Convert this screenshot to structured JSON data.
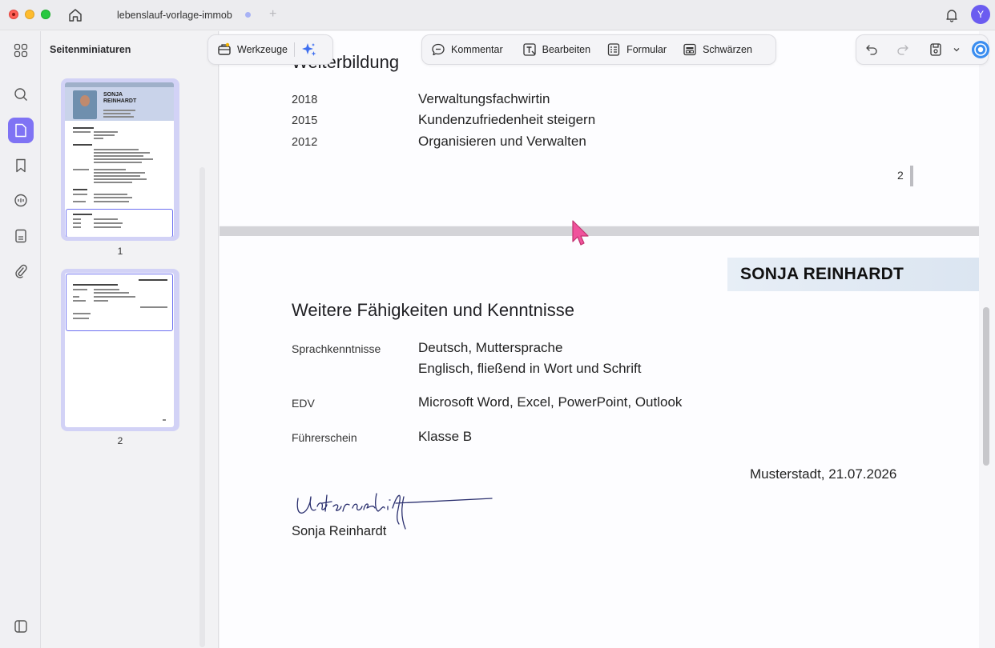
{
  "titlebar": {
    "tab_title": "lebenslauf-vorlage-immob",
    "new_tab": "+",
    "avatar_initial": "Y"
  },
  "thumbnails": {
    "title": "Seitenminiaturen",
    "pages": [
      {
        "number": "1",
        "name_line1": "SONJA",
        "name_line2": "REINHARDT"
      },
      {
        "number": "2"
      }
    ]
  },
  "toolbar": {
    "tools_label": "Werkzeuge",
    "comment_label": "Kommentar",
    "edit_label": "Bearbeiten",
    "form_label": "Formular",
    "redact_label": "Schwärzen"
  },
  "document": {
    "page1": {
      "section_title": "Weiterbildung",
      "rows": [
        {
          "year": "2018",
          "value": "Verwaltungsfachwirtin"
        },
        {
          "year": "2015",
          "value": "Kundenzufriedenheit steigern"
        },
        {
          "year": "2012",
          "value": "Organisieren und Verwalten"
        }
      ],
      "page_number": "2"
    },
    "page2": {
      "name_banner": "SONJA REINHARDT",
      "section_title": "Weitere Fähigkeiten und Kenntnisse",
      "skills": [
        {
          "label": "Sprachkenntnisse",
          "lines": [
            "Deutsch, Muttersprache",
            "Englisch, fließend in Wort und Schrift"
          ]
        },
        {
          "label": "EDV",
          "lines": [
            "Microsoft Word, Excel, PowerPoint, Outlook"
          ]
        },
        {
          "label": "Führerschein",
          "lines": [
            "Klasse B"
          ]
        }
      ],
      "place_date": "Musterstadt, 21.07.2026",
      "signature_name": "Sonja Reinhardt"
    }
  },
  "colors": {
    "accent": "#7f73f4",
    "thumb_selection": "#6b6ff0",
    "cursor": "#f0529c"
  }
}
